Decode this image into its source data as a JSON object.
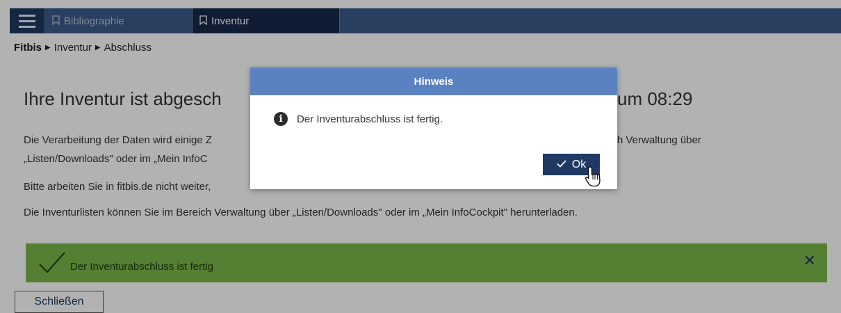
{
  "nav": {
    "tabs": [
      {
        "label": "Bibliographie",
        "active": false
      },
      {
        "label": "Inventur",
        "active": true
      }
    ]
  },
  "breadcrumb": [
    "Fitbis",
    "Inventur",
    "Abschluss"
  ],
  "main": {
    "headline_left": "Ihre Inventur ist abgesch",
    "headline_right": "um 08:29",
    "para1_left": "Die Verarbeitung der Daten wird einige Z",
    "para1_right": "h Verwaltung über",
    "para2_left": "„Listen/Downloads\" oder im „Mein InfoC",
    "para3": "Bitte arbeiten Sie in fitbis.de nicht weiter,",
    "para4": "Die Inventurlisten können Sie im Bereich Verwaltung über „Listen/Downloads\" oder im „Mein InfoCockpit\" herunterladen."
  },
  "alert": {
    "message": "Der Inventurabschluss ist fertig",
    "color": "#7ab648"
  },
  "close_button": "Schließen",
  "modal": {
    "title": "Hinweis",
    "message": "Der Inventurabschluss ist fertig.",
    "ok_label": "Ok"
  }
}
